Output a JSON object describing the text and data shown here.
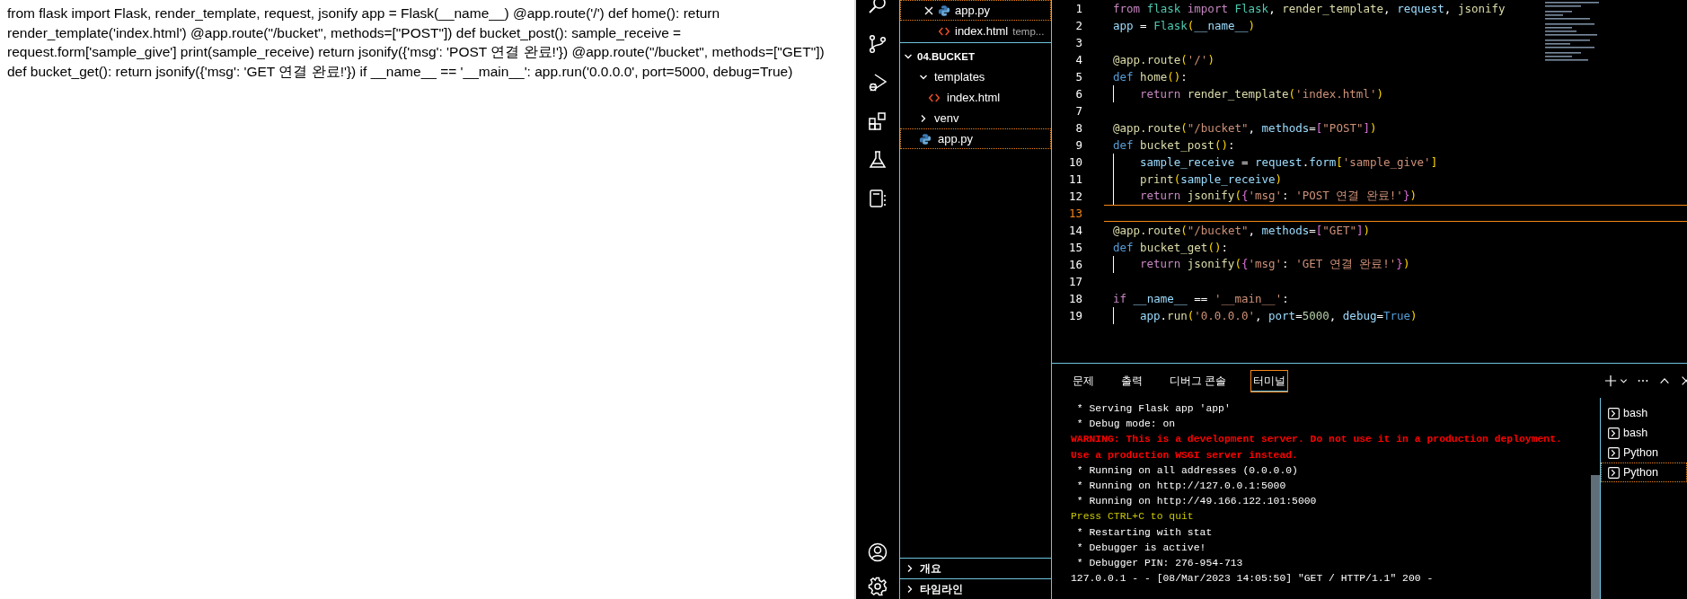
{
  "browser_page": {
    "text": "from flask import Flask, render_template, request, jsonify app = Flask(__name__) @app.route('/') def home(): return render_template('index.html') @app.route(\"/bucket\", methods=[\"POST\"]) def bucket_post(): sample_receive = request.form['sample_give'] print(sample_receive) return jsonify({'msg': 'POST 연결 완료!'}) @app.route(\"/bucket\", methods=[\"GET\"]) def bucket_get(): return jsonify({'msg': 'GET 연결 완료!'}) if __name__ == '__main__': app.run('0.0.0.0', port=5000, debug=True)"
  },
  "sidebar": {
    "open_editors": [
      {
        "label": "app.py",
        "kind": "python",
        "selected": true
      },
      {
        "label": "index.html",
        "kind": "html",
        "hint": "temp...",
        "selected": false
      }
    ],
    "explorer": {
      "title": "04.BUCKET",
      "expanded": true,
      "items": [
        {
          "label": "templates",
          "kind": "folder",
          "expanded": true,
          "selected": false,
          "children": [
            {
              "label": "index.html",
              "kind": "html",
              "selected": false
            }
          ]
        },
        {
          "label": "venv",
          "kind": "folder",
          "expanded": false,
          "selected": false
        },
        {
          "label": "app.py",
          "kind": "python",
          "selected": true
        }
      ]
    },
    "sections": [
      {
        "label": "개요",
        "expanded": false
      },
      {
        "label": "타임라인",
        "expanded": false
      }
    ]
  },
  "editor": {
    "lines": [
      {
        "number": "1",
        "current": false,
        "indented": false,
        "tokens": [
          {
            "text": "from ",
            "kind": "control"
          },
          {
            "text": "flask ",
            "kind": "class"
          },
          {
            "text": "import ",
            "kind": "control"
          },
          {
            "text": "Flask",
            "kind": "class"
          },
          {
            "text": ", ",
            "kind": "punctuation"
          },
          {
            "text": "render_template",
            "kind": "function"
          },
          {
            "text": ", ",
            "kind": "punctuation"
          },
          {
            "text": "request",
            "kind": "variable"
          },
          {
            "text": ", ",
            "kind": "punctuation"
          },
          {
            "text": "jsonify",
            "kind": "function"
          }
        ]
      },
      {
        "number": "2",
        "current": false,
        "indented": false,
        "tokens": [
          {
            "text": "app",
            "kind": "variable"
          },
          {
            "text": " = ",
            "kind": "punctuation"
          },
          {
            "text": "Flask",
            "kind": "class"
          },
          {
            "text": "(",
            "kind": "paren"
          },
          {
            "text": "__name__",
            "kind": "variable"
          },
          {
            "text": ")",
            "kind": "paren"
          }
        ]
      },
      {
        "number": "3",
        "current": false,
        "indented": false
      },
      {
        "number": "4",
        "current": false,
        "indented": false,
        "tokens": [
          {
            "text": "@app.route",
            "kind": "function"
          },
          {
            "text": "(",
            "kind": "paren"
          },
          {
            "text": "'/'",
            "kind": "string"
          },
          {
            "text": ")",
            "kind": "paren"
          }
        ]
      },
      {
        "number": "5",
        "current": false,
        "indented": false,
        "tokens": [
          {
            "text": "def ",
            "kind": "keyword"
          },
          {
            "text": "home",
            "kind": "function"
          },
          {
            "text": "()",
            "kind": "paren"
          },
          {
            "text": ":",
            "kind": "punctuation"
          }
        ]
      },
      {
        "number": "6",
        "current": false,
        "indented": true,
        "tokens": [
          {
            "text": "return ",
            "kind": "control"
          },
          {
            "text": "render_template",
            "kind": "function"
          },
          {
            "text": "(",
            "kind": "paren"
          },
          {
            "text": "'index.html'",
            "kind": "string"
          },
          {
            "text": ")",
            "kind": "paren"
          }
        ]
      },
      {
        "number": "7",
        "current": false,
        "indented": false
      },
      {
        "number": "8",
        "current": false,
        "indented": false,
        "tokens": [
          {
            "text": "@app.route",
            "kind": "function"
          },
          {
            "text": "(",
            "kind": "paren"
          },
          {
            "text": "\"/bucket\"",
            "kind": "string"
          },
          {
            "text": ", ",
            "kind": "punctuation"
          },
          {
            "text": "methods",
            "kind": "variable"
          },
          {
            "text": "=",
            "kind": "punctuation"
          },
          {
            "text": "[",
            "kind": "bracket"
          },
          {
            "text": "\"POST\"",
            "kind": "string"
          },
          {
            "text": "]",
            "kind": "bracket"
          },
          {
            "text": ")",
            "kind": "paren"
          }
        ]
      },
      {
        "number": "9",
        "current": false,
        "indented": false,
        "tokens": [
          {
            "text": "def ",
            "kind": "keyword"
          },
          {
            "text": "bucket_post",
            "kind": "function"
          },
          {
            "text": "()",
            "kind": "paren"
          },
          {
            "text": ":",
            "kind": "punctuation"
          }
        ]
      },
      {
        "number": "10",
        "current": false,
        "indented": true,
        "tokens": [
          {
            "text": "sample_receive",
            "kind": "variable"
          },
          {
            "text": " = ",
            "kind": "punctuation"
          },
          {
            "text": "request",
            "kind": "variable"
          },
          {
            "text": ".",
            "kind": "punctuation"
          },
          {
            "text": "form",
            "kind": "variable"
          },
          {
            "text": "[",
            "kind": "paren"
          },
          {
            "text": "'sample_give'",
            "kind": "string"
          },
          {
            "text": "]",
            "kind": "paren"
          }
        ]
      },
      {
        "number": "11",
        "current": false,
        "indented": true,
        "tokens": [
          {
            "text": "print",
            "kind": "function"
          },
          {
            "text": "(",
            "kind": "paren"
          },
          {
            "text": "sample_receive",
            "kind": "variable"
          },
          {
            "text": ")",
            "kind": "paren"
          }
        ]
      },
      {
        "number": "12",
        "current": false,
        "indented": true,
        "tokens": [
          {
            "text": "return ",
            "kind": "control"
          },
          {
            "text": "jsonify",
            "kind": "function"
          },
          {
            "text": "(",
            "kind": "paren"
          },
          {
            "text": "{",
            "kind": "bracket"
          },
          {
            "text": "'msg'",
            "kind": "string"
          },
          {
            "text": ": ",
            "kind": "punctuation"
          },
          {
            "text": "'POST 연결 완료!'",
            "kind": "string"
          },
          {
            "text": "}",
            "kind": "bracket"
          },
          {
            "text": ")",
            "kind": "paren"
          }
        ]
      },
      {
        "number": "13",
        "current": true,
        "indented": false
      },
      {
        "number": "14",
        "current": false,
        "indented": false,
        "tokens": [
          {
            "text": "@app.route",
            "kind": "function"
          },
          {
            "text": "(",
            "kind": "paren"
          },
          {
            "text": "\"/bucket\"",
            "kind": "string"
          },
          {
            "text": ", ",
            "kind": "punctuation"
          },
          {
            "text": "methods",
            "kind": "variable"
          },
          {
            "text": "=",
            "kind": "punctuation"
          },
          {
            "text": "[",
            "kind": "bracket"
          },
          {
            "text": "\"GET\"",
            "kind": "string"
          },
          {
            "text": "]",
            "kind": "bracket"
          },
          {
            "text": ")",
            "kind": "paren"
          }
        ]
      },
      {
        "number": "15",
        "current": false,
        "indented": false,
        "tokens": [
          {
            "text": "def ",
            "kind": "keyword"
          },
          {
            "text": "bucket_get",
            "kind": "function"
          },
          {
            "text": "()",
            "kind": "paren"
          },
          {
            "text": ":",
            "kind": "punctuation"
          }
        ]
      },
      {
        "number": "16",
        "current": false,
        "indented": true,
        "tokens": [
          {
            "text": "return ",
            "kind": "control"
          },
          {
            "text": "jsonify",
            "kind": "function"
          },
          {
            "text": "(",
            "kind": "paren"
          },
          {
            "text": "{",
            "kind": "bracket"
          },
          {
            "text": "'msg'",
            "kind": "string"
          },
          {
            "text": ": ",
            "kind": "punctuation"
          },
          {
            "text": "'GET 연결 완료!'",
            "kind": "string"
          },
          {
            "text": "}",
            "kind": "bracket"
          },
          {
            "text": ")",
            "kind": "paren"
          }
        ]
      },
      {
        "number": "17",
        "current": false,
        "indented": false
      },
      {
        "number": "18",
        "current": false,
        "indented": false,
        "tokens": [
          {
            "text": "if ",
            "kind": "control"
          },
          {
            "text": "__name__",
            "kind": "variable"
          },
          {
            "text": " == ",
            "kind": "punctuation"
          },
          {
            "text": "'__main__'",
            "kind": "string"
          },
          {
            "text": ":",
            "kind": "punctuation"
          }
        ]
      },
      {
        "number": "19",
        "current": false,
        "indented": true,
        "tokens": [
          {
            "text": "app",
            "kind": "variable"
          },
          {
            "text": ".",
            "kind": "punctuation"
          },
          {
            "text": "run",
            "kind": "function"
          },
          {
            "text": "(",
            "kind": "paren"
          },
          {
            "text": "'0.0.0.0'",
            "kind": "string"
          },
          {
            "text": ", ",
            "kind": "punctuation"
          },
          {
            "text": "port",
            "kind": "variable"
          },
          {
            "text": "=",
            "kind": "punctuation"
          },
          {
            "text": "5000",
            "kind": "number"
          },
          {
            "text": ", ",
            "kind": "punctuation"
          },
          {
            "text": "debug",
            "kind": "variable"
          },
          {
            "text": "=",
            "kind": "punctuation"
          },
          {
            "text": "True",
            "kind": "keyword"
          },
          {
            "text": ")",
            "kind": "paren"
          }
        ]
      }
    ]
  },
  "panel": {
    "tabs": [
      {
        "label": "문제",
        "selected": false
      },
      {
        "label": "출력",
        "selected": false
      },
      {
        "label": "디버그 콘솔",
        "selected": false
      },
      {
        "label": "터미널",
        "selected": true
      }
    ],
    "terminal": [
      {
        "text": " * Serving Flask app 'app'",
        "kind": "plain"
      },
      {
        "text": " * Debug mode: on",
        "kind": "plain"
      },
      {
        "text": "WARNING: This is a development server. Do not use it in a production deployment.",
        "kind": "warning"
      },
      {
        "text": "Use a production WSGI server instead.",
        "kind": "warning"
      },
      {
        "text": " * Running on all addresses (0.0.0.0)",
        "kind": "plain"
      },
      {
        "text": " * Running on http://127.0.0.1:5000",
        "kind": "plain"
      },
      {
        "text": " * Running on http://49.166.122.101:5000",
        "kind": "plain"
      },
      {
        "text": "Press CTRL+C to quit",
        "kind": "hint"
      },
      {
        "text": " * Restarting with stat",
        "kind": "plain"
      },
      {
        "text": " * Debugger is active!",
        "kind": "plain"
      },
      {
        "text": " * Debugger PIN: 276-954-713",
        "kind": "plain"
      },
      {
        "text": "127.0.0.1 - - [08/Mar/2023 14:05:50] \"GET / HTTP/1.1\" 200 -",
        "kind": "plain"
      }
    ],
    "terminals": [
      {
        "label": "bash",
        "selected": false
      },
      {
        "label": "bash",
        "selected": false
      },
      {
        "label": "Python",
        "selected": false
      },
      {
        "label": "Python",
        "selected": true
      }
    ]
  }
}
